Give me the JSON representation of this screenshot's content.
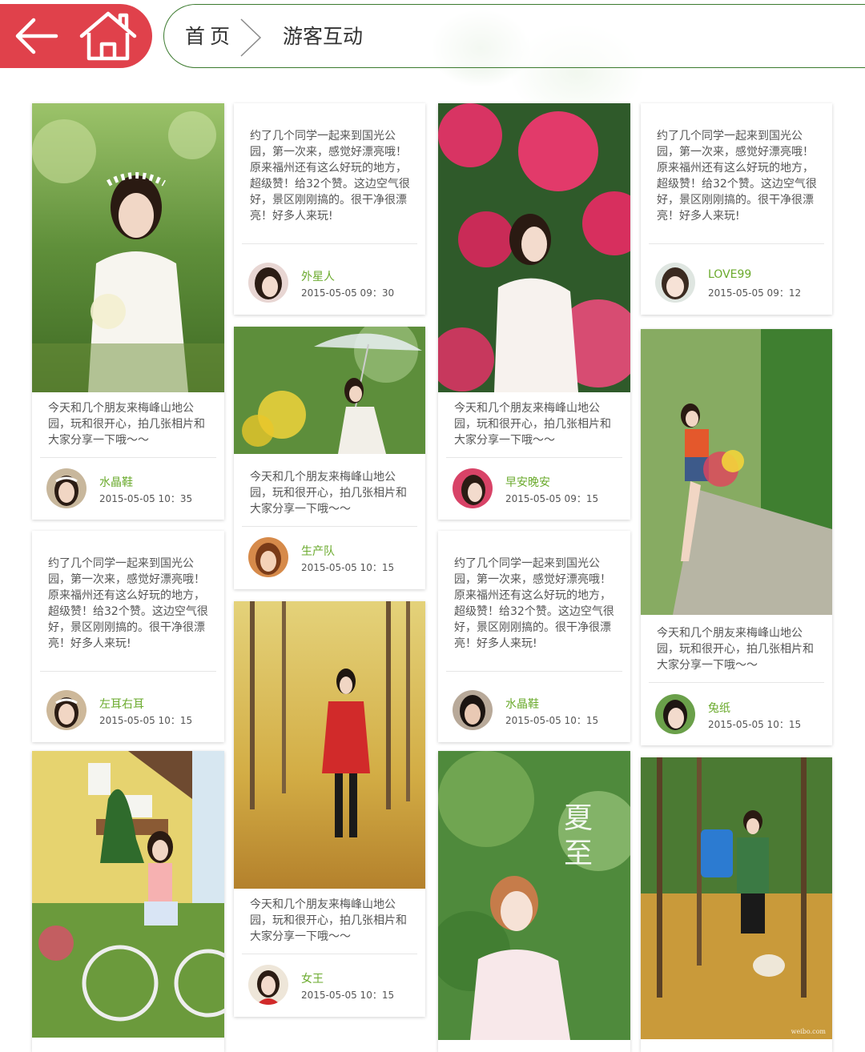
{
  "header": {
    "breadcrumb_home": "首页",
    "breadcrumb_current": "游客互动",
    "accent_color": "#e0414b",
    "line_color": "#3b7a2e"
  },
  "cards": [
    {
      "text": "今天和几个朋友来梅峰山地公园，玩和很开心，拍几张相片和大家分享一下哦～～",
      "user": "水晶鞋",
      "time": "2015-05-05  10：35"
    },
    {
      "text": "约了几个同学一起来到国光公园，第一次来，感觉好漂亮哦！原来福州还有这么好玩的地方，超级赞！给32个赞。这边空气很好，景区刚刚搞的。很干净很漂亮！好多人来玩!",
      "user": "左耳右耳",
      "time": "2015-05-05  10：15"
    },
    {
      "text": "约了几个同学一起来到国光公园，第一次来，感觉好漂亮哦！原来福州还有这么好玩的地方，超级赞！给32个赞。这边空气很好，景区刚刚搞的。很干净很漂亮！好多人来玩!",
      "user": "外星人",
      "time": "2015-05-05  09：30"
    },
    {
      "text": "今天和几个朋友来梅峰山地公园，玩和很开心，拍几张相片和大家分享一下哦～～",
      "user": "生产队",
      "time": "2015-05-05  10：15"
    },
    {
      "text": "今天和几个朋友来梅峰山地公园，玩和很开心，拍几张相片和大家分享一下哦～～",
      "user": "女王",
      "time": "2015-05-05  10：15"
    },
    {
      "text": "今天和几个朋友来梅峰山地公园，玩和很开心，拍几张相片和大家分享一下哦～～",
      "user": "早安晚安",
      "time": "2015-05-05  09：15"
    },
    {
      "text": "约了几个同学一起来到国光公园，第一次来，感觉好漂亮哦！原来福州还有这么好玩的地方，超级赞！给32个赞。这边空气很好，景区刚刚搞的。很干净很漂亮！好多人来玩!",
      "user": "水晶鞋",
      "time": "2015-05-05  10：15"
    },
    {
      "text": "约了几个同学一起来到国光公园，第一次来，感觉好漂亮哦！原来福州还有这么好玩的地方，超级赞！给32个赞。这边空气很好，景区刚刚搞的。很干净很漂亮！好多人来玩!",
      "user": "LOVE99",
      "time": "2015-05-05  09：12"
    },
    {
      "text": "今天和几个朋友来梅峰山地公园，玩和很开心，拍几张相片和大家分享一下哦～～",
      "user": "兔纸",
      "time": "2015-05-05  10：15"
    }
  ],
  "photo_captions": {
    "summer_title": "夏至",
    "weibo_mark": "weibo.com"
  }
}
